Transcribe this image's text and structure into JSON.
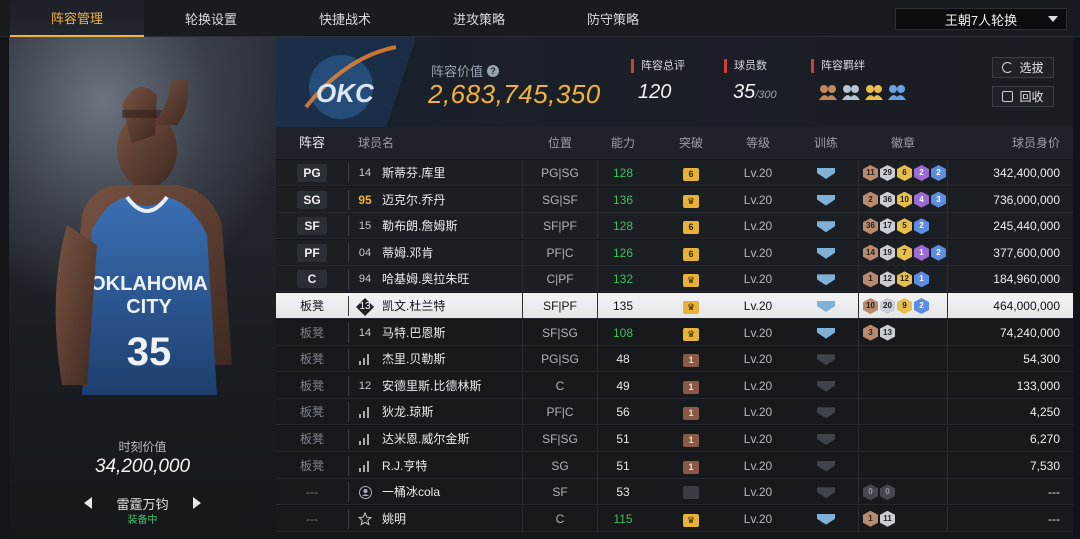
{
  "tabs": [
    "阵容管理",
    "轮换设置",
    "快捷战术",
    "进攻策略",
    "防守策略"
  ],
  "active_tab": 0,
  "rotation_select": "王朝7人轮换",
  "card": {
    "value_label": "时刻价值",
    "value": "34,200,000",
    "player_name": "雷霆万钧",
    "status": "装备中"
  },
  "header": {
    "value_label": "阵容价值",
    "value": "2,683,745,350",
    "rating_label": "阵容总评",
    "rating": "120",
    "count_label": "球员数",
    "count": "35",
    "count_max": "/300",
    "bond_label": "阵容羁绊",
    "select_button": "选拔",
    "recycle_button": "回收"
  },
  "columns": [
    "阵容",
    "球员名",
    "位置",
    "能力",
    "突破",
    "等级",
    "训练",
    "徽章",
    "球员身价"
  ],
  "rows": [
    {
      "slot": "PG",
      "num": "14",
      "name": "斯蒂芬.库里",
      "pos": "PG|SG",
      "ability": "128",
      "ability_color": "green",
      "breakthrough": "6",
      "break_style": "gold",
      "level": "Lv.20",
      "train": "blue",
      "badges": [
        [
          "11",
          "brown"
        ],
        [
          "29",
          "silver"
        ],
        [
          "6",
          "gold"
        ],
        [
          "2",
          "purple"
        ],
        [
          "2",
          "blue"
        ]
      ],
      "value": "342,400,000",
      "type": "starter"
    },
    {
      "slot": "SG",
      "num": "95",
      "gold_num": true,
      "name": "迈克尔.乔丹",
      "pos": "SG|SF",
      "ability": "136",
      "ability_color": "green",
      "breakthrough": "♛",
      "break_style": "gold",
      "level": "Lv.20",
      "train": "blue",
      "badges": [
        [
          "2",
          "brown"
        ],
        [
          "36",
          "silver"
        ],
        [
          "10",
          "gold"
        ],
        [
          "4",
          "purple"
        ],
        [
          "3",
          "blue"
        ]
      ],
      "value": "736,000,000",
      "type": "starter"
    },
    {
      "slot": "SF",
      "num": "15",
      "name": "勒布朗.詹姆斯",
      "pos": "SF|PF",
      "ability": "128",
      "ability_color": "green",
      "breakthrough": "6",
      "break_style": "gold",
      "level": "Lv.20",
      "train": "blue",
      "badges": [
        [
          "36",
          "brown"
        ],
        [
          "17",
          "silver"
        ],
        [
          "5",
          "gold"
        ],
        [
          "2",
          "blue"
        ]
      ],
      "value": "245,440,000",
      "type": "starter"
    },
    {
      "slot": "PF",
      "num": "04",
      "name": "蒂姆.邓肯",
      "pos": "PF|C",
      "ability": "126",
      "ability_color": "green",
      "breakthrough": "6",
      "break_style": "gold",
      "level": "Lv.20",
      "train": "blue",
      "badges": [
        [
          "14",
          "brown"
        ],
        [
          "19",
          "silver"
        ],
        [
          "7",
          "gold"
        ],
        [
          "1",
          "purple"
        ],
        [
          "2",
          "blue"
        ]
      ],
      "value": "377,600,000",
      "type": "starter"
    },
    {
      "slot": "C",
      "num": "94",
      "name": "哈基姆.奥拉朱旺",
      "pos": "C|PF",
      "ability": "132",
      "ability_color": "green",
      "breakthrough": "♛",
      "break_style": "gold",
      "level": "Lv.20",
      "train": "blue",
      "badges": [
        [
          "1",
          "brown"
        ],
        [
          "12",
          "silver"
        ],
        [
          "12",
          "gold"
        ],
        [
          "1",
          "blue"
        ]
      ],
      "value": "184,960,000",
      "type": "starter"
    },
    {
      "slot": "板凳",
      "num": "13",
      "name": "凯文.杜兰特",
      "pos": "SF|PF",
      "ability": "135",
      "ability_color": "white",
      "breakthrough": "♛",
      "break_style": "gold",
      "level": "Lv.20",
      "train": "blue",
      "badges": [
        [
          "10",
          "brown"
        ],
        [
          "20",
          "silver"
        ],
        [
          "9",
          "gold"
        ],
        [
          "2",
          "blue"
        ]
      ],
      "value": "464,000,000",
      "type": "selected"
    },
    {
      "slot": "板凳",
      "num": "14",
      "icon": "bars",
      "name": "马特.巴恩斯",
      "pos": "SF|SG",
      "ability": "108",
      "ability_color": "green",
      "breakthrough": "♛",
      "break_style": "gold",
      "level": "Lv.20",
      "train": "blue",
      "badges": [
        [
          "3",
          "brown"
        ],
        [
          "13",
          "silver"
        ]
      ],
      "value": "74,240,000",
      "type": "bench"
    },
    {
      "slot": "板凳",
      "num": "",
      "icon": "bars",
      "name": "杰里.贝勒斯",
      "pos": "PG|SG",
      "ability": "48",
      "ability_color": "white",
      "breakthrough": "1",
      "break_style": "bronze",
      "level": "Lv.20",
      "train": "grey",
      "badges": [],
      "value": "54,300",
      "type": "bench"
    },
    {
      "slot": "板凳",
      "num": "12",
      "name": "安德里斯.比德林斯",
      "pos": "C",
      "ability": "49",
      "ability_color": "white",
      "breakthrough": "1",
      "break_style": "bronze",
      "level": "Lv.20",
      "train": "grey",
      "badges": [],
      "value": "133,000",
      "type": "bench"
    },
    {
      "slot": "板凳",
      "num": "",
      "icon": "bars",
      "name": "狄龙.琼斯",
      "pos": "PF|C",
      "ability": "56",
      "ability_color": "white",
      "breakthrough": "1",
      "break_style": "bronze",
      "level": "Lv.20",
      "train": "grey",
      "badges": [],
      "value": "4,250",
      "type": "bench"
    },
    {
      "slot": "板凳",
      "num": "",
      "icon": "bars",
      "name": "达米恩.威尔金斯",
      "pos": "SF|SG",
      "ability": "51",
      "ability_color": "white",
      "breakthrough": "1",
      "break_style": "bronze",
      "level": "Lv.20",
      "train": "grey",
      "badges": [],
      "value": "6,270",
      "type": "bench"
    },
    {
      "slot": "板凳",
      "num": "",
      "icon": "bars",
      "name": "R.J.亨特",
      "pos": "SG",
      "ability": "51",
      "ability_color": "white",
      "breakthrough": "1",
      "break_style": "bronze",
      "level": "Lv.20",
      "train": "grey",
      "badges": [],
      "value": "7,530",
      "type": "bench"
    },
    {
      "slot": "---",
      "num": "",
      "icon": "person",
      "name": "一桶冰cola",
      "pos": "SF",
      "ability": "53",
      "ability_color": "white",
      "breakthrough": "",
      "break_style": "dark",
      "level": "Lv.20",
      "train": "grey",
      "badges": [
        [
          "0",
          "dark"
        ],
        [
          "0",
          "dark"
        ]
      ],
      "value": "---",
      "type": "bench"
    },
    {
      "slot": "---",
      "num": "",
      "icon": "star",
      "name": "姚明",
      "pos": "C",
      "ability": "115",
      "ability_color": "green",
      "breakthrough": "♛",
      "break_style": "gold",
      "level": "Lv.20",
      "train": "blue",
      "badges": [
        [
          "1",
          "brown"
        ],
        [
          "11",
          "silver"
        ]
      ],
      "value": "---",
      "type": "bench"
    }
  ]
}
